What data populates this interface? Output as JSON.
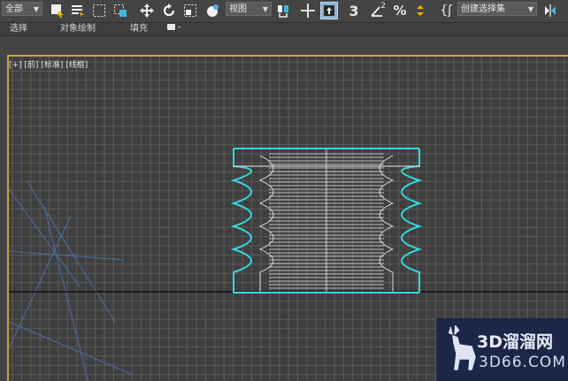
{
  "toolbar": {
    "selection_filter": "全部",
    "view_dropdown": "视图",
    "snap_toggle_label": "3",
    "angle_snap_label": "2",
    "named_selection_set": "创建选择集"
  },
  "ribbon": {
    "tabs": [
      "选择",
      "对象绘制",
      "填充"
    ]
  },
  "viewport": {
    "label": "[+] [前] [标准] [线框]",
    "grid_color": "#5b5b5b",
    "object_color": "#34d8de",
    "border_color": "#c8a23a"
  },
  "watermark": {
    "line1": "3D溜溜网",
    "line2": "3D66.COM"
  },
  "icons": [
    "select-icon",
    "select-by-name-icon",
    "rect-region-icon",
    "window-crossing-icon",
    "move-icon",
    "rotate-icon",
    "scale-icon",
    "place-icon",
    "select-link-icon",
    "pivot-icon",
    "manipulate-icon",
    "snap-icon",
    "angle-snap-icon",
    "percent-snap-icon",
    "spinner-snap-icon",
    "edit-named-sets-icon",
    "mirror-icon"
  ]
}
